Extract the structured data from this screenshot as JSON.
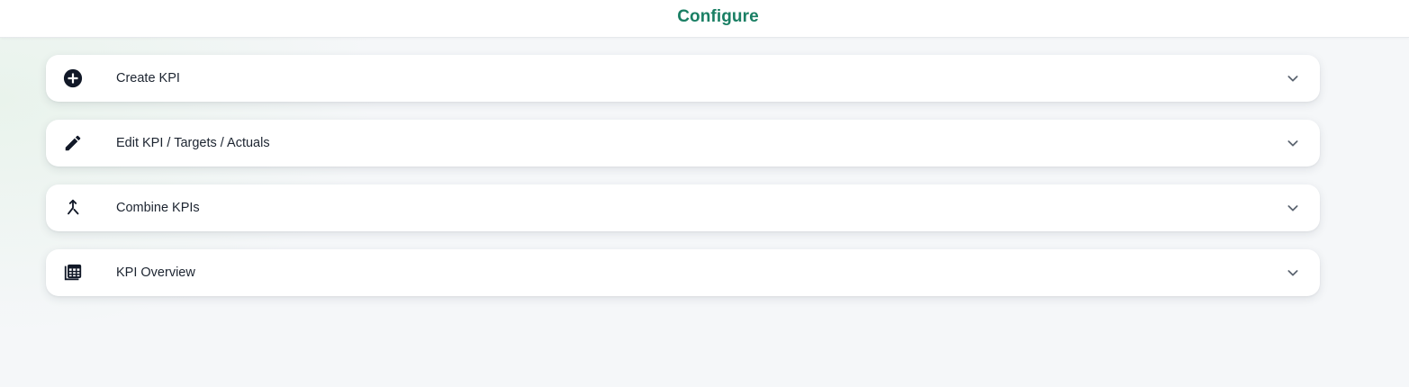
{
  "header": {
    "title": "Configure"
  },
  "colors": {
    "accent": "#1a7f64",
    "icon": "#111827",
    "chevron": "#5b6470"
  },
  "items": [
    {
      "label": "Create KPI",
      "icon": "add-circle-icon"
    },
    {
      "label": "Edit KPI / Targets / Actuals",
      "icon": "pencil-icon"
    },
    {
      "label": "Combine KPIs",
      "icon": "merge-icon"
    },
    {
      "label": "KPI Overview",
      "icon": "table-overview-icon"
    }
  ]
}
